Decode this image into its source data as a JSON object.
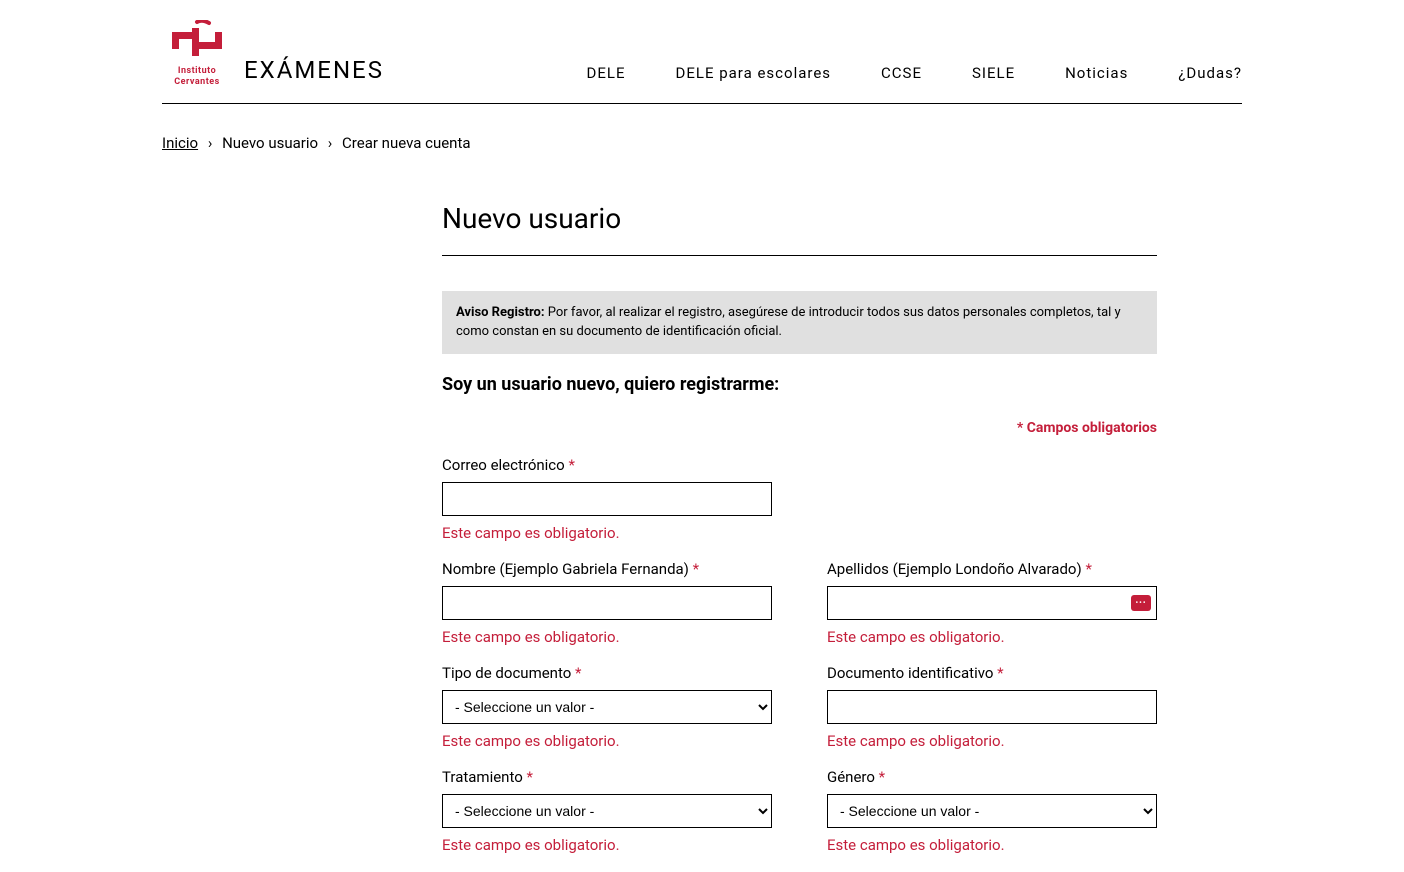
{
  "header": {
    "logo_text_line1": "Instituto",
    "logo_text_line2": "Cervantes",
    "brand": "EXÁMENES",
    "nav": {
      "dele": "DELE",
      "dele_escolares": "DELE para escolares",
      "ccse": "CCSE",
      "siele": "SIELE",
      "noticias": "Noticias",
      "dudas": "¿Dudas?"
    }
  },
  "breadcrumb": {
    "inicio": "Inicio",
    "nuevo_usuario": "Nuevo usuario",
    "crear_cuenta": "Crear nueva cuenta"
  },
  "page": {
    "title": "Nuevo usuario",
    "notice_label": "Aviso Registro:",
    "notice_text": " Por favor, al realizar el registro, asegúrese de introducir todos sus datos personales completos, tal y como constan en su documento de identificación oficial.",
    "subtitle": "Soy un usuario nuevo, quiero registrarme:",
    "required_note": "* Campos obligatorios"
  },
  "form": {
    "email_label": "Correo electrónico ",
    "nombre_label": "Nombre (Ejemplo Gabriela Fernanda) ",
    "apellidos_label": "Apellidos (Ejemplo Londoño Alvarado) ",
    "tipo_doc_label": "Tipo de documento ",
    "doc_id_label": "Documento identificativo ",
    "tratamiento_label": "Tratamiento ",
    "genero_label": "Género ",
    "select_placeholder": "- Seleccione un valor -",
    "error_required": "Este campo es obligatorio.",
    "asterisk": "*"
  }
}
